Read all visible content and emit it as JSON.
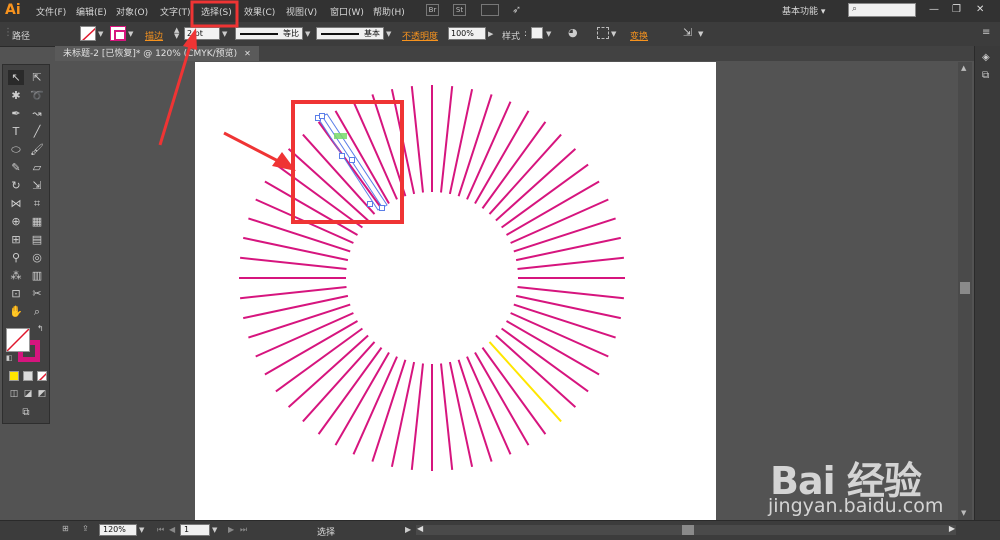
{
  "app": {
    "logo": "Ai"
  },
  "menu": [
    "文件(F)",
    "编辑(E)",
    "对象(O)",
    "文字(T)",
    "选择(S)",
    "效果(C)",
    "视图(V)",
    "窗口(W)",
    "帮助(H)"
  ],
  "menubar_icons": {
    "br": "Br",
    "st": "St"
  },
  "workspace": {
    "label": "基本功能",
    "arrow": "▾"
  },
  "window_buttons": {
    "minimize": "—",
    "maximize": "❐",
    "close": "✕"
  },
  "control_bar": {
    "object_type": "路径",
    "stroke_label": "描边",
    "stroke_value": "2 pt",
    "profile_label": "等比",
    "brush_label": "基本",
    "opacity_label": "不透明度",
    "opacity_value": "100%",
    "style_label": "样式",
    "transform_label": "变换"
  },
  "document_tab": {
    "title": "未标题-2 [已恢复]* @ 120% (CMYK/预览)",
    "close": "✕"
  },
  "status_bar": {
    "zoom": "120%",
    "page": "1",
    "tool_name": "选择"
  },
  "watermark": {
    "brand": "Bai 经验",
    "url": "jingyan.baidu.com"
  },
  "colors": {
    "line": "#d6157e",
    "selected_line": "#ffe600",
    "annotation": "#ef3434",
    "selection_box": "#5b7ee8",
    "fill_swatch": "#d6157e"
  },
  "artwork": {
    "line_count": 60,
    "highlight_index": 23
  }
}
